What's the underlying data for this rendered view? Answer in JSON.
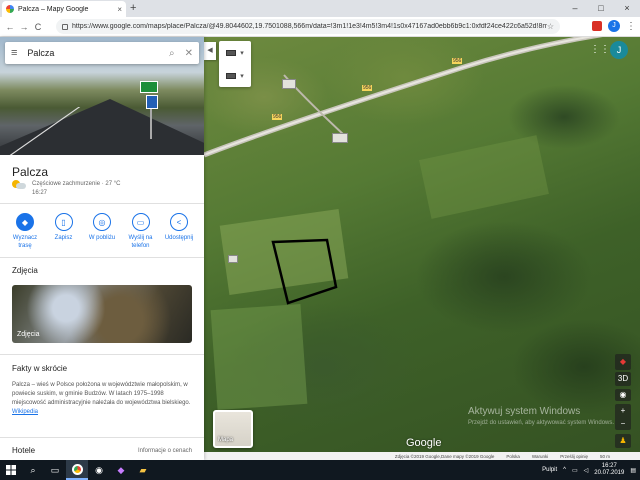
{
  "browser": {
    "tab_title": "Palcza – Mapy Google",
    "tab_close": "×",
    "new_tab": "+",
    "url": "https://www.google.com/maps/place/Palcza/@49.8044602,19.7501088,566m/data=!3m1!1e3!4m5!3m4!1s0x47167ad0ebb6b9c1:0xfdf24ce422c6a52d!8m2!3",
    "win_min": "–",
    "win_max": "□",
    "win_close": "×",
    "back": "←",
    "forward": "→",
    "reload": "C",
    "star": "☆",
    "menu": "⋮",
    "avatar": "J"
  },
  "panel": {
    "search_value": "Palcza",
    "search_icon": "⌕",
    "clear_icon": "✕",
    "menu_icon": "≡",
    "title": "Palcza",
    "weather_line1": "Częściowe zachmurzenie · 27 °C",
    "weather_line2": "16:27",
    "actions": [
      {
        "label": "Wyznacz trasę",
        "icon": "directions-icon",
        "glyph": "◆"
      },
      {
        "label": "Zapisz",
        "icon": "bookmark-icon",
        "glyph": "▯"
      },
      {
        "label": "W pobliżu",
        "icon": "nearby-icon",
        "glyph": "◎"
      },
      {
        "label": "Wyślij na telefon",
        "icon": "phone-icon",
        "glyph": "▭"
      },
      {
        "label": "Udostępnij",
        "icon": "share-icon",
        "glyph": "<"
      }
    ],
    "photos_heading": "Zdjęcia",
    "photo_caption": "Zdjęcia",
    "facts_heading": "Fakty w skrócie",
    "facts_text": "Palcza – wieś w Polsce położona w województwie małopolskim, w powiecie suskim, w gminie Budzów. W latach 1975–1998 miejscowość administracyjnie należała do województwa bielskiego.",
    "facts_link": "Wikipedia",
    "hotels_heading": "Hotele",
    "hotels_info": "Informacje o cenach",
    "collapse": "◀"
  },
  "map": {
    "road_label_1": "956",
    "road_label_2": "956",
    "road_label_3": "956",
    "minimap_label": "Mapa",
    "google_logo": "Google",
    "apps_icon": "⋮⋮⋮",
    "avatar": "J",
    "view_3d": "3D",
    "zoom_in": "+",
    "zoom_out": "−",
    "watermark_title": "Aktywuj system Windows",
    "watermark_sub": "Przejdź do ustawień, aby aktywować system Windows.",
    "status": [
      "Zdjęcia ©2019 Google,Dane mapy ©2019 Google",
      "Polska",
      "Warunki",
      "Prześlij opinię",
      "50 m"
    ]
  },
  "taskbar": {
    "tray_label": "Pulpit",
    "time": "16:27",
    "date": "20.07.2019"
  }
}
